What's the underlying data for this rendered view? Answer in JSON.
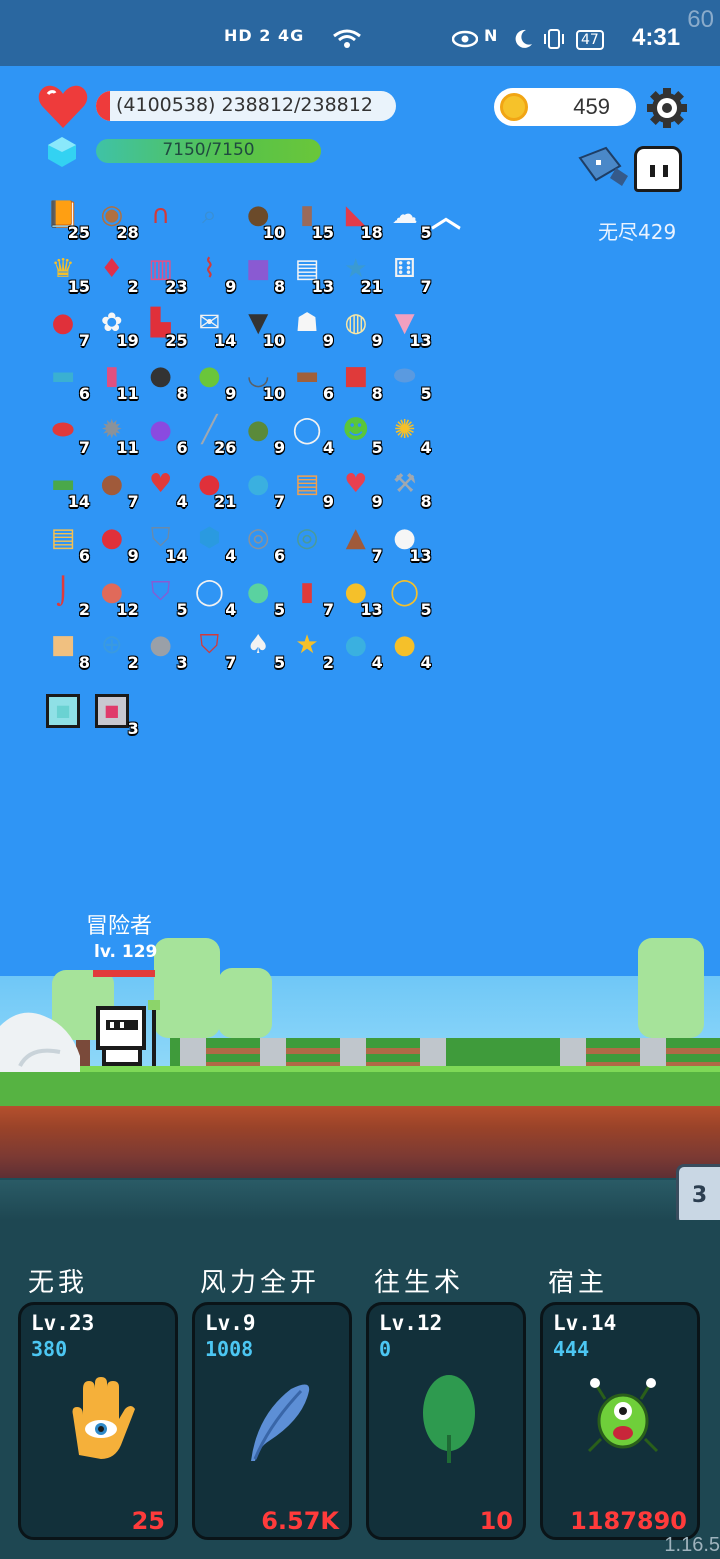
{
  "status_bar": {
    "left_indicators": "HD 2  4G",
    "right_indicators": "N",
    "battery": "47",
    "time": "4:31",
    "fps": "60"
  },
  "player": {
    "hp_text": "(4100538) 238812/238812",
    "mp_text": "7150/7150",
    "coins": "459"
  },
  "stage": {
    "mode_label": "无尽429"
  },
  "inventory": [
    {
      "icon": "book",
      "count": "25"
    },
    {
      "icon": "shield-round",
      "count": "28"
    },
    {
      "icon": "magnet",
      "count": ""
    },
    {
      "icon": "magnifier",
      "count": ""
    },
    {
      "icon": "coconut",
      "count": "10"
    },
    {
      "icon": "tombstone",
      "count": "15"
    },
    {
      "icon": "watermelon",
      "count": "18"
    },
    {
      "icon": "cloud",
      "count": "5"
    },
    {
      "icon": "crown",
      "count": "15"
    },
    {
      "icon": "ruby",
      "count": "2"
    },
    {
      "icon": "jam-jar",
      "count": "23"
    },
    {
      "icon": "thermometer",
      "count": "9"
    },
    {
      "icon": "purple-box",
      "count": "8"
    },
    {
      "icon": "clipboard",
      "count": "13"
    },
    {
      "icon": "star-card",
      "count": "21"
    },
    {
      "icon": "dice",
      "count": "7"
    },
    {
      "icon": "strawberry",
      "count": "7"
    },
    {
      "icon": "flower",
      "count": "19"
    },
    {
      "icon": "sock",
      "count": "25"
    },
    {
      "icon": "envelope",
      "count": "14"
    },
    {
      "icon": "bat",
      "count": "10"
    },
    {
      "icon": "ghost",
      "count": "9"
    },
    {
      "icon": "bulb",
      "count": "9"
    },
    {
      "icon": "ice-cream",
      "count": "13"
    },
    {
      "icon": "scroll",
      "count": "6"
    },
    {
      "icon": "spray-bottle",
      "count": "11"
    },
    {
      "icon": "cauldron",
      "count": "8"
    },
    {
      "icon": "lime",
      "count": "9"
    },
    {
      "icon": "mortar",
      "count": "10"
    },
    {
      "icon": "treasure-chest",
      "count": "6"
    },
    {
      "icon": "gift",
      "count": "8"
    },
    {
      "icon": "capsule-blue",
      "count": "5"
    },
    {
      "icon": "capsule-red",
      "count": "7"
    },
    {
      "icon": "mace",
      "count": "11"
    },
    {
      "icon": "crystal-ball",
      "count": "6"
    },
    {
      "icon": "sword",
      "count": "26"
    },
    {
      "icon": "grenade",
      "count": "9"
    },
    {
      "icon": "halo",
      "count": "4"
    },
    {
      "icon": "zombie",
      "count": "5"
    },
    {
      "icon": "sunflower",
      "count": "4"
    },
    {
      "icon": "cash",
      "count": "14"
    },
    {
      "icon": "meat",
      "count": "7"
    },
    {
      "icon": "broken-heart",
      "count": "4"
    },
    {
      "icon": "apple",
      "count": "21"
    },
    {
      "icon": "chat",
      "count": "7"
    },
    {
      "icon": "parchment",
      "count": "9"
    },
    {
      "icon": "heart",
      "count": "9"
    },
    {
      "icon": "axe",
      "count": "8"
    },
    {
      "icon": "map",
      "count": "6"
    },
    {
      "icon": "mushroom",
      "count": "9"
    },
    {
      "icon": "shield",
      "count": "14"
    },
    {
      "icon": "sapphire",
      "count": "4"
    },
    {
      "icon": "compass",
      "count": "6"
    },
    {
      "icon": "round-shield",
      "count": ""
    },
    {
      "icon": "cake",
      "count": "7"
    },
    {
      "icon": "fried-egg",
      "count": "13"
    },
    {
      "icon": "hook",
      "count": "2"
    },
    {
      "icon": "steak",
      "count": "12"
    },
    {
      "icon": "star-shield",
      "count": "5"
    },
    {
      "icon": "noose",
      "count": "4"
    },
    {
      "icon": "potion-green",
      "count": "5"
    },
    {
      "icon": "bookmark",
      "count": "7"
    },
    {
      "icon": "alarm",
      "count": "13"
    },
    {
      "icon": "ring",
      "count": "5"
    },
    {
      "icon": "fist",
      "count": "8"
    },
    {
      "icon": "crosshair",
      "count": "2"
    },
    {
      "icon": "meteor",
      "count": "3"
    },
    {
      "icon": "crest-shield",
      "count": "7"
    },
    {
      "icon": "cards",
      "count": "5"
    },
    {
      "icon": "magic-wand",
      "count": "2"
    },
    {
      "icon": "bomb-potion",
      "count": "4"
    },
    {
      "icon": "coins-stack",
      "count": "4"
    },
    {
      "icon": "lamp-frame",
      "count": ""
    },
    {
      "icon": "blade-frame",
      "count": "3"
    }
  ],
  "hero": {
    "name": "冒险者",
    "level": "lv. 129"
  },
  "side_tab": "3",
  "skills": [
    {
      "title": "无我",
      "level": "Lv.23",
      "value": "380",
      "cost": "25",
      "icon": "eye-hand-icon"
    },
    {
      "title": "风力全开",
      "level": "Lv.9",
      "value": "1008",
      "cost": "6.57K",
      "icon": "feather-icon"
    },
    {
      "title": "往生术",
      "level": "Lv.12",
      "value": "0",
      "cost": "10",
      "icon": "leaf-icon"
    },
    {
      "title": "宿主",
      "level": "Lv.14",
      "value": "444",
      "cost": "1187890",
      "icon": "parasite-icon"
    }
  ],
  "version": "1.16.5",
  "colors": {
    "sky": "#2f95f5",
    "status_bar": "#2a67a0",
    "hp": "#ee3b3b",
    "cost": "#ff3b3b",
    "skill_value": "#4cc6f2"
  }
}
